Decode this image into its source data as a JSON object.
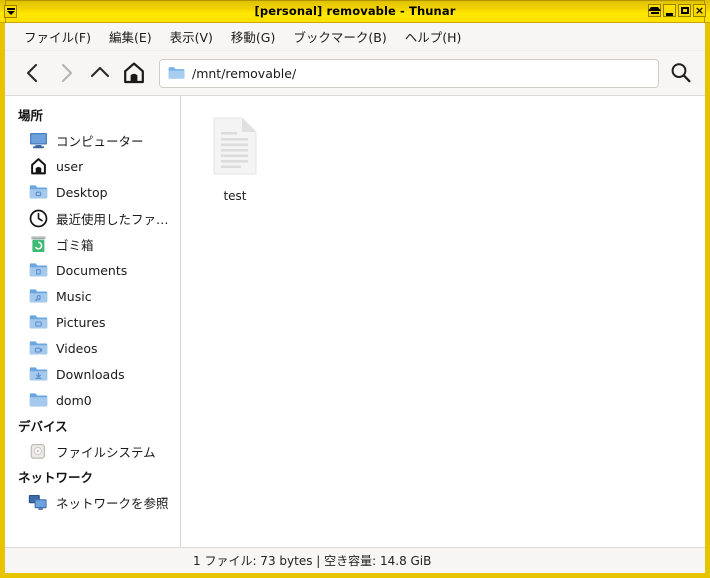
{
  "window": {
    "title": "[personal] removable - Thunar",
    "titlebar_buttons": [
      {
        "name": "shade-button",
        "label": "Shade"
      },
      {
        "name": "minimize-button",
        "label": "Minimize"
      },
      {
        "name": "maximize-button",
        "label": "Maximize"
      },
      {
        "name": "close-button",
        "label": "×"
      }
    ],
    "menu_button": "window-menu-button",
    "accent_color": "#ffe000",
    "border_color": "#e8c400"
  },
  "menubar": {
    "items": [
      {
        "label": "ファイル(F)",
        "name": "menu-file"
      },
      {
        "label": "編集(E)",
        "name": "menu-edit"
      },
      {
        "label": "表示(V)",
        "name": "menu-view"
      },
      {
        "label": "移動(G)",
        "name": "menu-go"
      },
      {
        "label": "ブックマーク(B)",
        "name": "menu-bookmarks"
      },
      {
        "label": "ヘルプ(H)",
        "name": "menu-help"
      }
    ]
  },
  "toolbar": {
    "back": "back-button",
    "forward": "forward-button",
    "up": "up-button",
    "home": "home-button",
    "search": "search-button",
    "path_value": "/mnt/removable/",
    "path_placeholder": "/mnt/removable/"
  },
  "sidebar": {
    "groups": [
      {
        "label": "場所",
        "name": "sidebar-group-places",
        "items": [
          {
            "label": "コンピューター",
            "icon": "computer-icon",
            "name": "sidebar-item-computer"
          },
          {
            "label": "user",
            "icon": "home-icon",
            "name": "sidebar-item-user"
          },
          {
            "label": "Desktop",
            "icon": "folder-desktop-icon",
            "name": "sidebar-item-desktop"
          },
          {
            "label": "最近使用したファ…",
            "icon": "clock-icon",
            "name": "sidebar-item-recent"
          },
          {
            "label": "ゴミ箱",
            "icon": "trash-icon",
            "name": "sidebar-item-trash"
          },
          {
            "label": "Documents",
            "icon": "folder-documents-icon",
            "name": "sidebar-item-documents"
          },
          {
            "label": "Music",
            "icon": "folder-music-icon",
            "name": "sidebar-item-music"
          },
          {
            "label": "Pictures",
            "icon": "folder-pictures-icon",
            "name": "sidebar-item-pictures"
          },
          {
            "label": "Videos",
            "icon": "folder-videos-icon",
            "name": "sidebar-item-videos"
          },
          {
            "label": "Downloads",
            "icon": "folder-downloads-icon",
            "name": "sidebar-item-downloads"
          },
          {
            "label": "dom0",
            "icon": "folder-icon",
            "name": "sidebar-item-dom0"
          }
        ]
      },
      {
        "label": "デバイス",
        "name": "sidebar-group-devices",
        "items": [
          {
            "label": "ファイルシステム",
            "icon": "harddisk-icon",
            "name": "sidebar-item-filesystem"
          }
        ]
      },
      {
        "label": "ネットワーク",
        "name": "sidebar-group-network",
        "items": [
          {
            "label": "ネットワークを参照",
            "icon": "network-icon",
            "name": "sidebar-item-browse-network"
          }
        ]
      }
    ]
  },
  "content": {
    "files": [
      {
        "name": "test",
        "icon": "text-document-icon"
      }
    ]
  },
  "statusbar": {
    "text": "1 ファイル: 73 bytes  |  空き容量: 14.8 GiB"
  }
}
